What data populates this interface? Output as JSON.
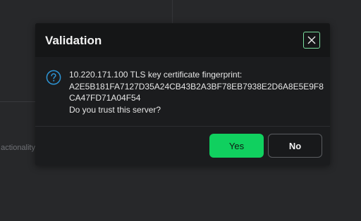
{
  "background": {
    "partial_text": "actionality."
  },
  "dialog": {
    "title": "Validation",
    "close_icon": "close-icon",
    "info_icon": "question-circle-icon",
    "message_lines": [
      "10.220.171.100 TLS key certificate fingerprint:",
      "A2E5B181FA7127D35A24CB43B2A3BF78EB7938E2D6A8E5E9F8",
      "CA47FD71A04F54",
      "Do you trust this server?"
    ],
    "yes_label": "Yes",
    "no_label": "No"
  },
  "colors": {
    "accent": "#10d05f",
    "close_border": "#7be09e",
    "info_icon": "#2d95d6"
  }
}
